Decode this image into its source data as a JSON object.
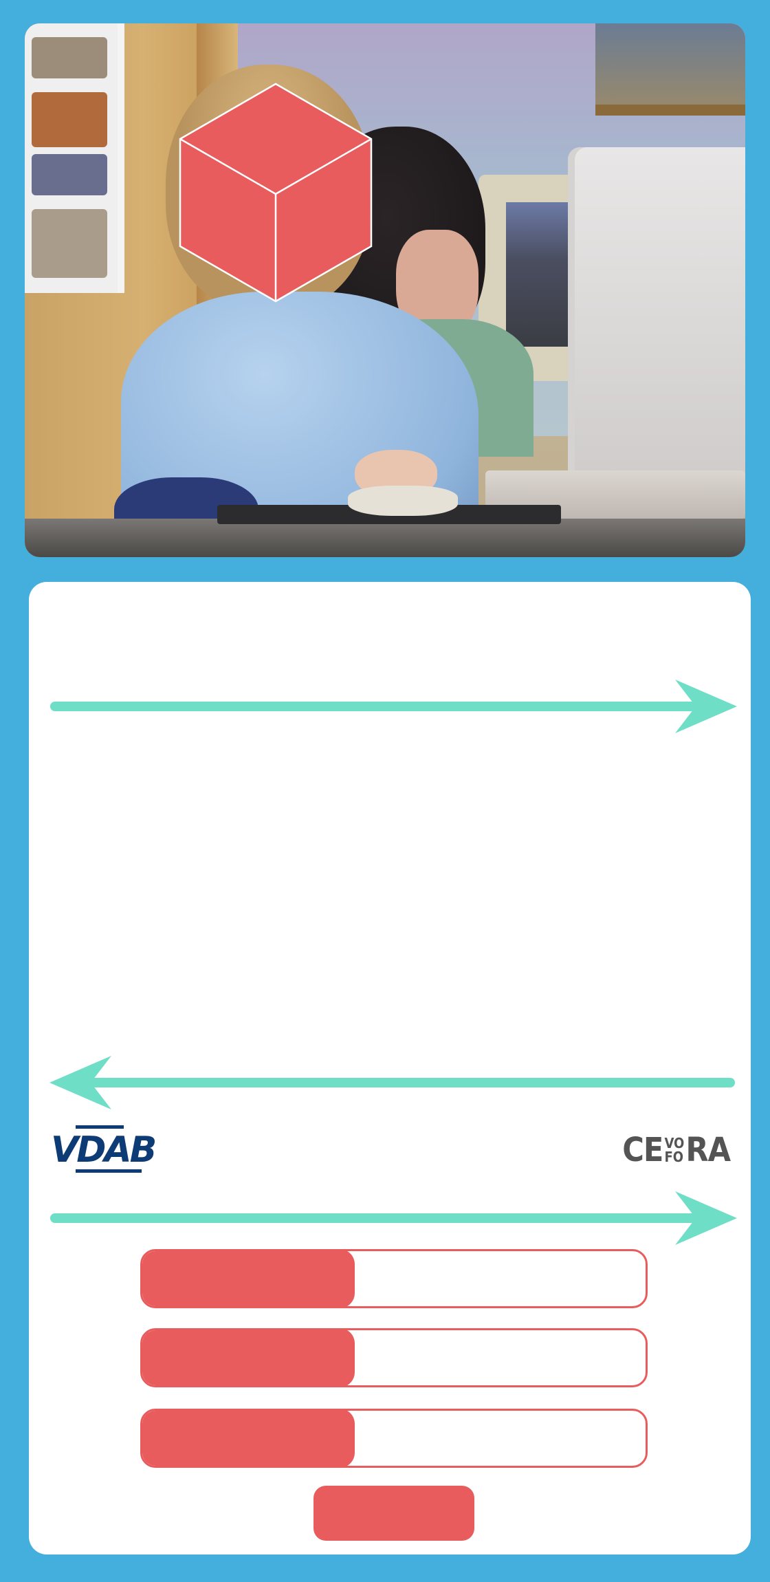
{
  "colors": {
    "background": "#44aedc",
    "panel": "#ffffff",
    "accent": "#e85c5d",
    "arrow": "#6edec6",
    "vdab_blue": "#0d3b75",
    "cevora_gray": "#545454"
  },
  "photo": {
    "overlay_icon": "cube-icon"
  },
  "logos": {
    "vdab": "VDAB",
    "cevora_left": "CE",
    "cevora_top": "VO",
    "cevora_bottom": "FO",
    "cevora_right": "RA"
  },
  "form": {
    "fields": [
      {
        "label": "",
        "value": ""
      },
      {
        "label": "",
        "value": ""
      },
      {
        "label": "",
        "value": ""
      }
    ],
    "submit_label": ""
  },
  "icons": {
    "arrow_top": "arrow-right-icon",
    "arrow_middle": "arrow-left-icon",
    "arrow_bottom": "arrow-right-icon"
  }
}
